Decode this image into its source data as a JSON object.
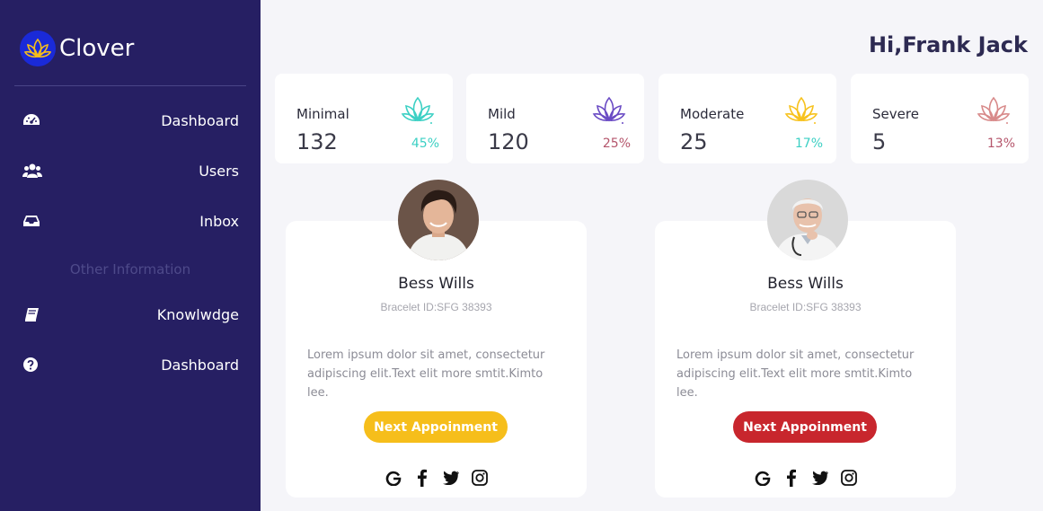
{
  "app": {
    "name": "Clover"
  },
  "header": {
    "greeting": "Hi,Frank Jack"
  },
  "sidebar": {
    "items": [
      {
        "label": "Dashboard",
        "icon": "speedometer-icon"
      },
      {
        "label": "Users",
        "icon": "users-icon"
      },
      {
        "label": "Inbox",
        "icon": "inbox-icon"
      },
      {
        "label": "Knowlwdge",
        "icon": "book-icon"
      },
      {
        "label": "Dashboard",
        "icon": "help-circle-icon"
      }
    ],
    "section_title": "Other Information"
  },
  "stats": [
    {
      "label": "Minimal",
      "value": "132",
      "percent": "45%",
      "color": "#3cd0c4",
      "pct_color": "#3cd0c4"
    },
    {
      "label": "Mild",
      "value": "120",
      "percent": "25%",
      "color": "#6a4bc4",
      "pct_color": "#b5566c"
    },
    {
      "label": "Moderate",
      "value": "25",
      "percent": "17%",
      "color": "#f7c21e",
      "pct_color": "#3cd0c4"
    },
    {
      "label": "Severe",
      "value": "5",
      "percent": "13%",
      "color": "#d88a8a",
      "pct_color": "#b5566c"
    }
  ],
  "profiles": [
    {
      "name": "Bess Wills",
      "bracelet": "Bracelet ID:SFG 38393",
      "description": "Lorem ipsum dolor sit amet, consectetur adipiscing elit.Text elit more smtit.Kimto lee.",
      "button_label": "Next Appoinment",
      "button_color": "#f6be1b"
    },
    {
      "name": "Bess Wills",
      "bracelet": "Bracelet ID:SFG 38393",
      "description": "Lorem ipsum dolor sit amet, consectetur adipiscing elit.Text elit more smtit.Kimto lee.",
      "button_label": "Next Appoinment",
      "button_color": "#c8262d"
    }
  ],
  "colors": {
    "sidebar_bg": "#261f63",
    "page_bg": "#f5f5f9"
  }
}
